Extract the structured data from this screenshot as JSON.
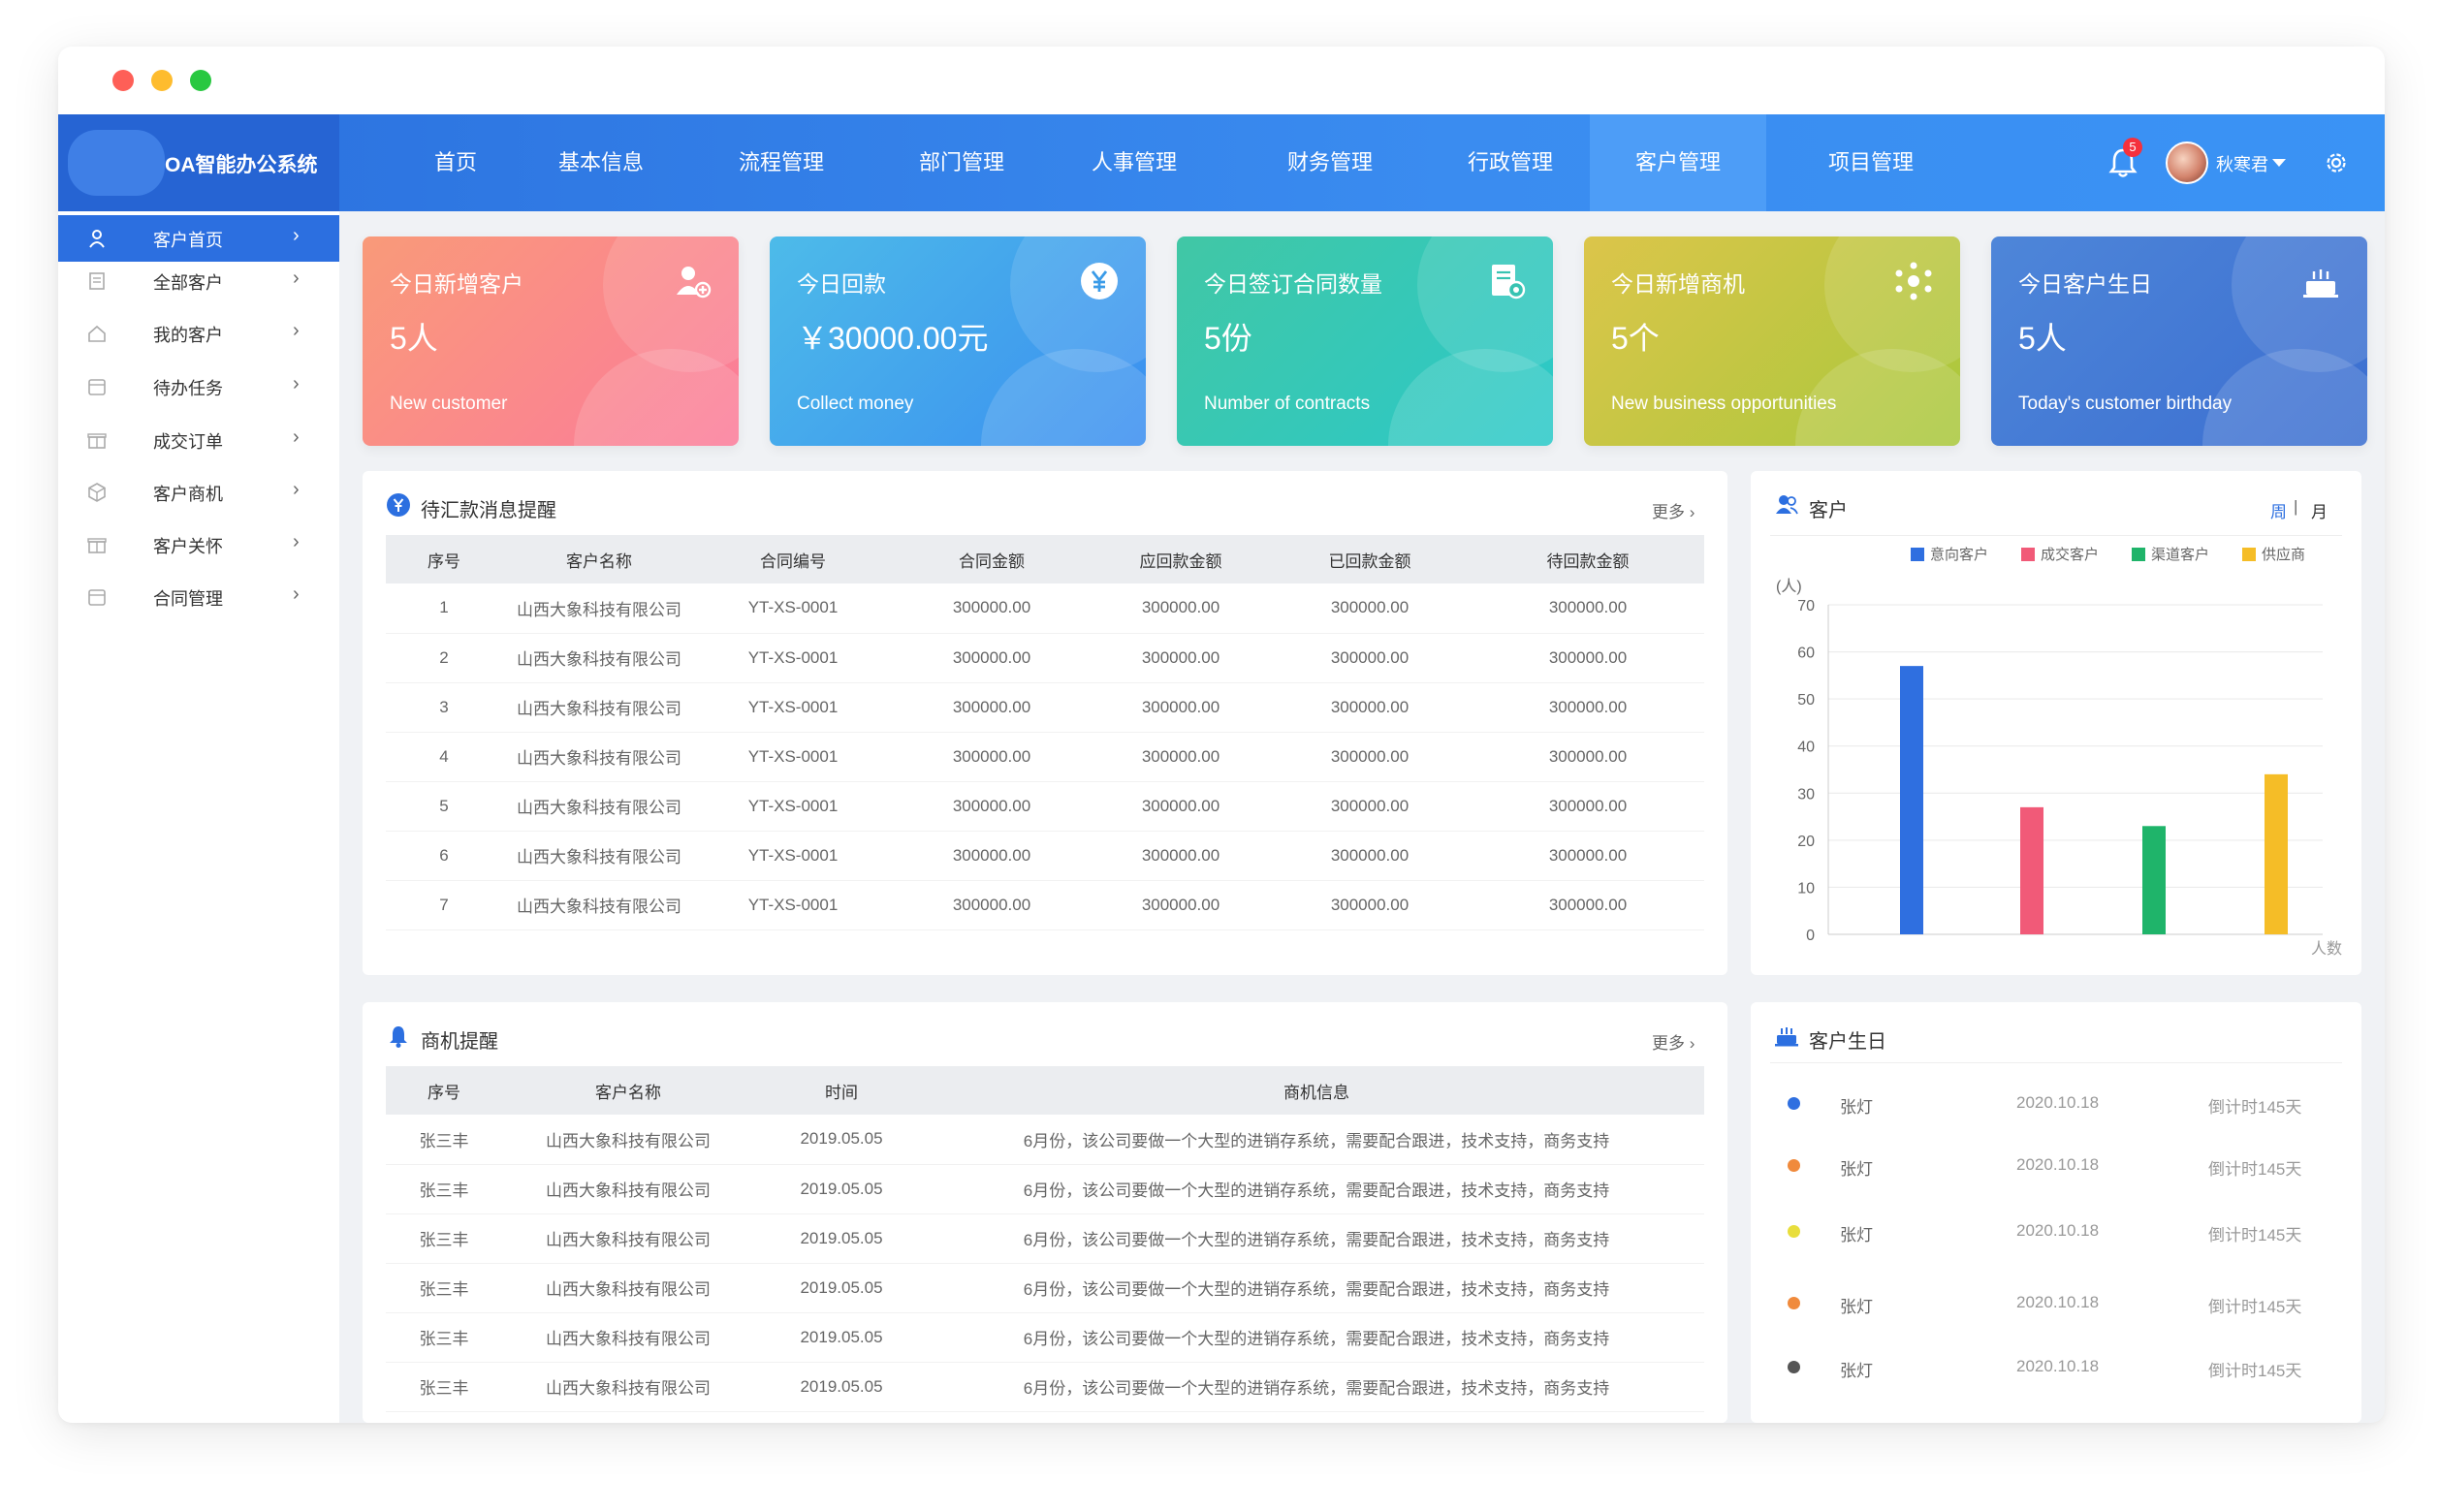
{
  "app": {
    "title": "OA智能办公系统"
  },
  "nav": {
    "items": [
      "首页",
      "基本信息",
      "流程管理",
      "部门管理",
      "人事管理",
      "财务管理",
      "行政管理",
      "客户管理",
      "项目管理"
    ],
    "active": "客户管理",
    "badge": "5",
    "user": "秋寒君"
  },
  "sidebar": {
    "items": [
      {
        "label": "客户首页",
        "icon": "person-icon",
        "arrow": "›"
      },
      {
        "label": "全部客户",
        "icon": "list-icon",
        "arrow": "›"
      },
      {
        "label": "我的客户",
        "icon": "home-icon",
        "arrow": "›"
      },
      {
        "label": "待办任务",
        "icon": "calendar-icon",
        "arrow": "›"
      },
      {
        "label": "成交订单",
        "icon": "gift-icon",
        "arrow": "›"
      },
      {
        "label": "客户商机",
        "icon": "cube-icon",
        "arrow": "›"
      },
      {
        "label": "客户关怀",
        "icon": "gift-icon",
        "arrow": "›"
      },
      {
        "label": "合同管理",
        "icon": "calendar-icon",
        "arrow": "›"
      }
    ]
  },
  "cards": [
    {
      "title": "今日新增客户",
      "value": "5人",
      "sub": "New customer",
      "icon": "add-user-icon",
      "colors": [
        "#f99a79",
        "#fb7b9a"
      ]
    },
    {
      "title": "今日回款",
      "value": "￥30000.00元",
      "sub": "Collect money",
      "icon": "yen-icon",
      "colors": [
        "#4dbbe9",
        "#3a8ef0"
      ]
    },
    {
      "title": "今日签订合同数量",
      "value": "5份",
      "sub": "Number of contracts",
      "icon": "contract-icon",
      "colors": [
        "#41c7a5",
        "#2bc9c9"
      ]
    },
    {
      "title": "今日新增商机",
      "value": "5个",
      "sub": "New business opportunities",
      "icon": "network-icon",
      "colors": [
        "#dcc54a",
        "#a8c83c"
      ]
    },
    {
      "title": "今日客户生日",
      "value": "5人",
      "sub": "Today's customer birthday",
      "icon": "cake-icon",
      "colors": [
        "#4e86d9",
        "#3b6ed0"
      ]
    }
  ],
  "payments": {
    "title": "待汇款消息提醒",
    "more": "更多",
    "headers": [
      "序号",
      "客户名称",
      "合同编号",
      "合同金额",
      "应回款金额",
      "已回款金额",
      "待回款金额"
    ],
    "rows": [
      [
        "1",
        "山西大象科技有限公司",
        "YT-XS-0001",
        "300000.00",
        "300000.00",
        "300000.00",
        "300000.00"
      ],
      [
        "2",
        "山西大象科技有限公司",
        "YT-XS-0001",
        "300000.00",
        "300000.00",
        "300000.00",
        "300000.00"
      ],
      [
        "3",
        "山西大象科技有限公司",
        "YT-XS-0001",
        "300000.00",
        "300000.00",
        "300000.00",
        "300000.00"
      ],
      [
        "4",
        "山西大象科技有限公司",
        "YT-XS-0001",
        "300000.00",
        "300000.00",
        "300000.00",
        "300000.00"
      ],
      [
        "5",
        "山西大象科技有限公司",
        "YT-XS-0001",
        "300000.00",
        "300000.00",
        "300000.00",
        "300000.00"
      ],
      [
        "6",
        "山西大象科技有限公司",
        "YT-XS-0001",
        "300000.00",
        "300000.00",
        "300000.00",
        "300000.00"
      ],
      [
        "7",
        "山西大象科技有限公司",
        "YT-XS-0001",
        "300000.00",
        "300000.00",
        "300000.00",
        "300000.00"
      ]
    ]
  },
  "opportunities": {
    "title": "商机提醒",
    "more": "更多",
    "headers": [
      "序号",
      "客户名称",
      "时间",
      "商机信息"
    ],
    "rows": [
      [
        "张三丰",
        "山西大象科技有限公司",
        "2019.05.05",
        "6月份，该公司要做一个大型的进销存系统，需要配合跟进，技术支持，商务支持"
      ],
      [
        "张三丰",
        "山西大象科技有限公司",
        "2019.05.05",
        "6月份，该公司要做一个大型的进销存系统，需要配合跟进，技术支持，商务支持"
      ],
      [
        "张三丰",
        "山西大象科技有限公司",
        "2019.05.05",
        "6月份，该公司要做一个大型的进销存系统，需要配合跟进，技术支持，商务支持"
      ],
      [
        "张三丰",
        "山西大象科技有限公司",
        "2019.05.05",
        "6月份，该公司要做一个大型的进销存系统，需要配合跟进，技术支持，商务支持"
      ],
      [
        "张三丰",
        "山西大象科技有限公司",
        "2019.05.05",
        "6月份，该公司要做一个大型的进销存系统，需要配合跟进，技术支持，商务支持"
      ],
      [
        "张三丰",
        "山西大象科技有限公司",
        "2019.05.05",
        "6月份，该公司要做一个大型的进销存系统，需要配合跟进，技术支持，商务支持"
      ]
    ]
  },
  "customer_chart": {
    "title": "客户",
    "toggle_week": "周",
    "toggle_sep": "|",
    "toggle_month": "月"
  },
  "chart_data": {
    "type": "bar",
    "categories": [
      "意向客户",
      "成交客户",
      "渠道客户",
      "供应商"
    ],
    "values": [
      57,
      27,
      23,
      34
    ],
    "colors": [
      "#2f6fe0",
      "#f15a78",
      "#1fb46a",
      "#f5bd27"
    ],
    "legend": [
      "意向客户",
      "成交客户",
      "渠道客户",
      "供应商"
    ],
    "legend_position": "top-right",
    "yunit": "(人)",
    "xlabel": "人数",
    "ylim": [
      0,
      70
    ],
    "yticks": [
      0,
      10,
      20,
      30,
      40,
      50,
      60,
      70
    ],
    "grid": true
  },
  "birthdays": {
    "title": "客户生日",
    "rows": [
      {
        "name": "张灯",
        "date": "2020.10.18",
        "countdown": "倒计时145天",
        "color": "#2f6fe0"
      },
      {
        "name": "张灯",
        "date": "2020.10.18",
        "countdown": "倒计时145天",
        "color": "#f08a3c"
      },
      {
        "name": "张灯",
        "date": "2020.10.18",
        "countdown": "倒计时145天",
        "color": "#e8de3c"
      },
      {
        "name": "张灯",
        "date": "2020.10.18",
        "countdown": "倒计时145天",
        "color": "#f08a3c"
      },
      {
        "name": "张灯",
        "date": "2020.10.18",
        "countdown": "倒计时145天",
        "color": "#555555"
      }
    ]
  }
}
